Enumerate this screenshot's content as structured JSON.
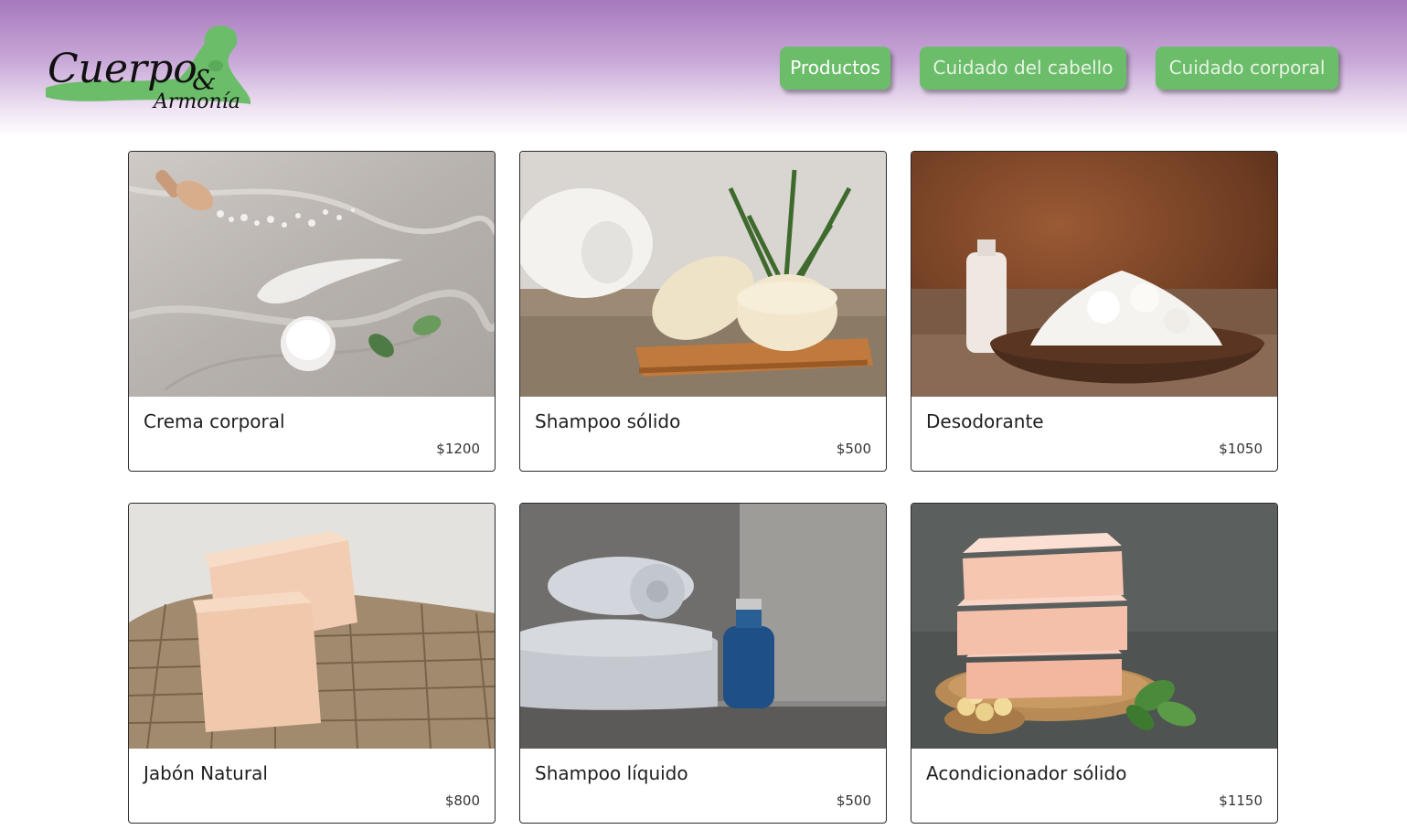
{
  "brand": {
    "logo_line1": "Cuerpo",
    "logo_amp": "&",
    "logo_line2": "Armonía",
    "accent_green": "#6bbd6a",
    "header_purple": "#a679bd"
  },
  "nav": {
    "items": [
      {
        "label": "Productos",
        "active": true
      },
      {
        "label": "Cuidado del cabello",
        "active": false
      },
      {
        "label": "Cuidado corporal",
        "active": false
      }
    ]
  },
  "products": [
    {
      "name": "Crema corporal",
      "price": "$1200",
      "image": "body-cream-photo"
    },
    {
      "name": "Shampoo sólido",
      "price": "$500",
      "image": "solid-shampoo-photo"
    },
    {
      "name": "Desodorante",
      "price": "$1050",
      "image": "deodorant-photo"
    },
    {
      "name": "Jabón Natural",
      "price": "$800",
      "image": "natural-soap-photo"
    },
    {
      "name": "Shampoo líquido",
      "price": "$500",
      "image": "liquid-shampoo-photo"
    },
    {
      "name": "Acondicionador sólido",
      "price": "$1150",
      "image": "solid-conditioner-photo"
    }
  ]
}
